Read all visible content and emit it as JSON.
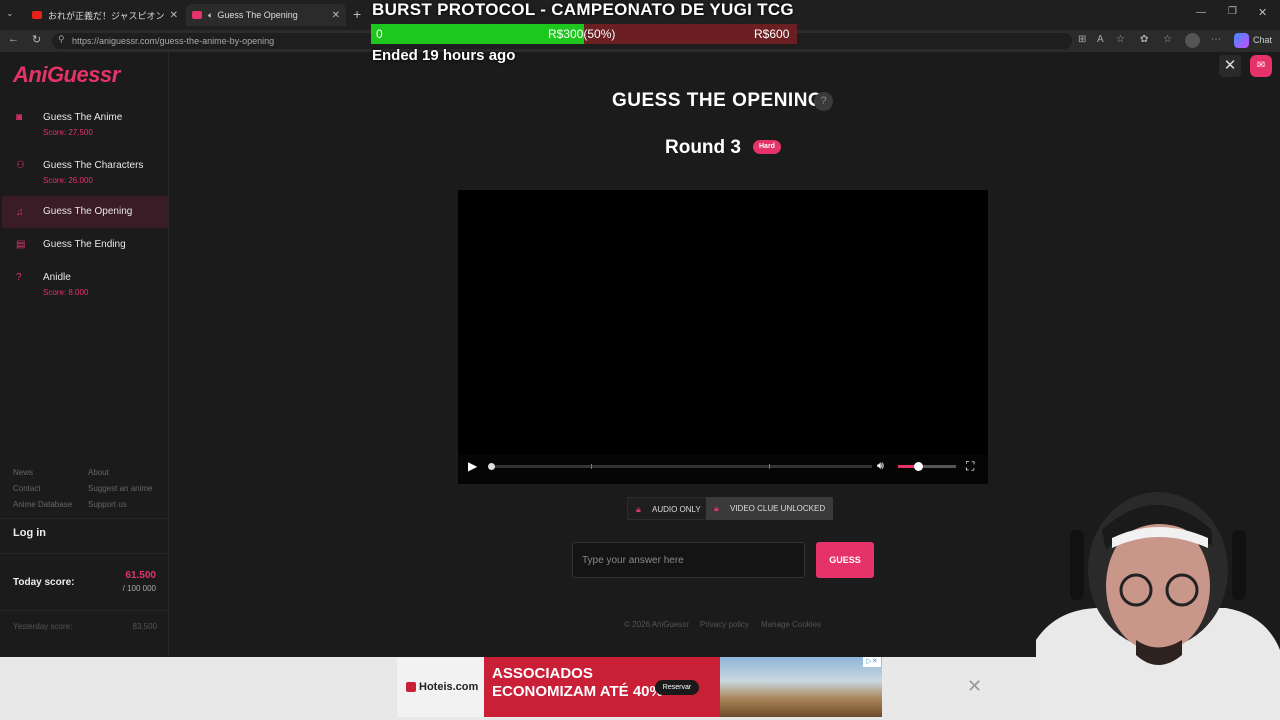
{
  "browser": {
    "tabs": [
      {
        "title": "おれが正義だ！ジャスピオン - YouTube"
      },
      {
        "title": "Guess The Opening"
      }
    ],
    "url": "https://aniguessr.com/guess-the-anime-by-opening",
    "chat_label": "Chat"
  },
  "overlay": {
    "title": "BURST PROTOCOL - CAMPEONATO DE YUGI TCG",
    "progress_percent": 50,
    "start": "0",
    "current": "R$300(50%)",
    "goal": "R$600",
    "ended": "Ended 19 hours ago"
  },
  "sidebar": {
    "logo": "AniGuessr",
    "items": [
      {
        "label": "Guess The Anime",
        "score": "Score: 27.500",
        "icon": "camera-icon"
      },
      {
        "label": "Guess The Characters",
        "score": "Score: 26.000",
        "icon": "users-icon"
      },
      {
        "label": "Guess The Opening",
        "score": "",
        "icon": "music-icon",
        "active": true
      },
      {
        "label": "Guess The Ending",
        "score": "",
        "icon": "film-icon"
      },
      {
        "label": "Anidle",
        "score": "Score: 8.000",
        "icon": "question-icon"
      }
    ],
    "links": [
      "News",
      "About",
      "Contact",
      "Suggest an anime",
      "Anime Database",
      "Support us"
    ],
    "login": "Log in",
    "today_label": "Today score:",
    "today_value": "61.500",
    "today_max": "/ 100 000",
    "yesterday_label": "Yesterday score:",
    "yesterday_value": "83.500"
  },
  "main": {
    "title": "GUESS THE OPENING",
    "help": "?",
    "round": "Round 3",
    "difficulty": "Hard",
    "clue_audio": "AUDIO ONLY",
    "clue_video": "VIDEO CLUE UNLOCKED",
    "answer_placeholder": "Type your answer here",
    "guess": "GUESS",
    "volume_level": 0.35
  },
  "footer": {
    "copyright": "© 2026 AniGuessr",
    "privacy": "Privacy policy",
    "cookies": "Manage Cookies"
  },
  "ad": {
    "brand": "Hoteis.com",
    "headline1": "ASSOCIADOS",
    "headline2": "ECONOMIZAM ATÉ 40%",
    "cta": "Reservar"
  },
  "colors": {
    "accent": "#e5336a",
    "overlay_green": "#1ec71e",
    "overlay_red": "#6b1f22"
  }
}
